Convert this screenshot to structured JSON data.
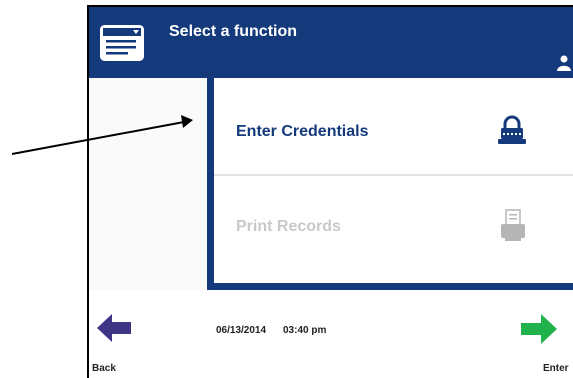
{
  "header": {
    "title": "Select a function",
    "menu_icon": "menu-card-icon",
    "user_icon": "user-icon"
  },
  "functions": [
    {
      "label": "Enter Credentials",
      "icon": "lock-icon",
      "enabled": true
    },
    {
      "label": "Print Records",
      "icon": "printer-icon",
      "enabled": false
    }
  ],
  "footer": {
    "back_label": "Back",
    "enter_label": "Enter",
    "date": "06/13/2014",
    "time": "03:40 pm"
  },
  "colors": {
    "brand": "#143a7c",
    "back_arrow": "#3f3585",
    "enter_arrow": "#22b24c",
    "disabled_text": "#c9c9c9"
  }
}
